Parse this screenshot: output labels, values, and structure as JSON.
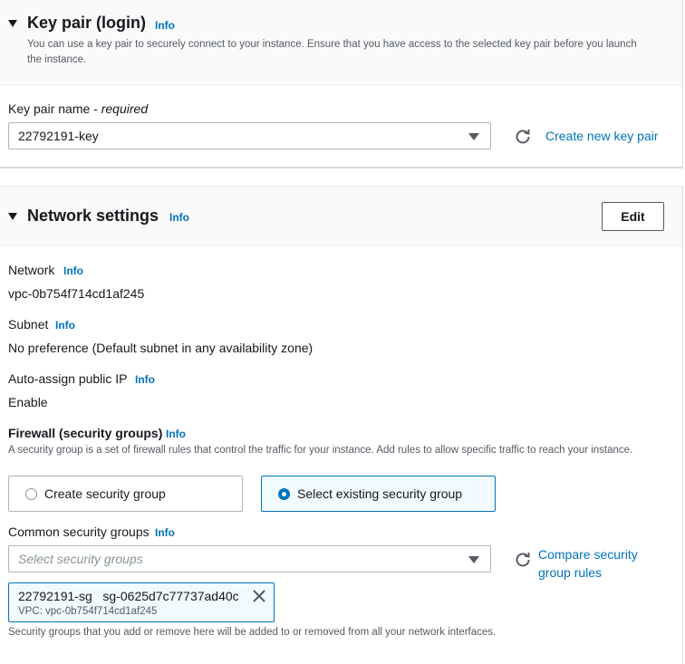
{
  "key_pair": {
    "title": "Key pair (login)",
    "info": "Info",
    "description": "You can use a key pair to securely connect to your instance. Ensure that you have access to the selected key pair before you launch the instance.",
    "field_label": "Key pair name",
    "field_required": "required",
    "selected": "22792191-key",
    "create_link": "Create new key pair"
  },
  "network": {
    "title": "Network settings",
    "info": "Info",
    "edit_button": "Edit",
    "network_label": "Network",
    "network_value": "vpc-0b754f714cd1af245",
    "subnet_label": "Subnet",
    "subnet_value": "No preference (Default subnet in any availability zone)",
    "public_ip_label": "Auto-assign public IP",
    "public_ip_value": "Enable",
    "firewall_label": "Firewall (security groups)",
    "firewall_description": "A security group is a set of firewall rules that control the traffic for your instance. Add rules to allow specific traffic to reach your instance.",
    "firewall_options": [
      {
        "label": "Create security group",
        "selected": false
      },
      {
        "label": "Select existing security group",
        "selected": true
      }
    ],
    "common_sg_label": "Common security groups",
    "common_sg_placeholder": "Select security groups",
    "compare_link": "Compare security group rules",
    "selected_group": {
      "name": "22792191-sg",
      "id": "sg-0625d7c77737ad40c",
      "vpc": "VPC: vpc-0b754f714cd1af245"
    },
    "footer_note": "Security groups that you add or remove here will be added to or removed from all your network interfaces."
  },
  "colors": {
    "link": "#0073bb",
    "header_bg": "#fafafa",
    "text": "#16191f",
    "muted": "#545b64",
    "selected_bg": "#f1faff"
  },
  "icons": [
    "caret-down-icon",
    "refresh-icon",
    "dropdown-arrow-icon",
    "radio-icon",
    "close-icon"
  ]
}
